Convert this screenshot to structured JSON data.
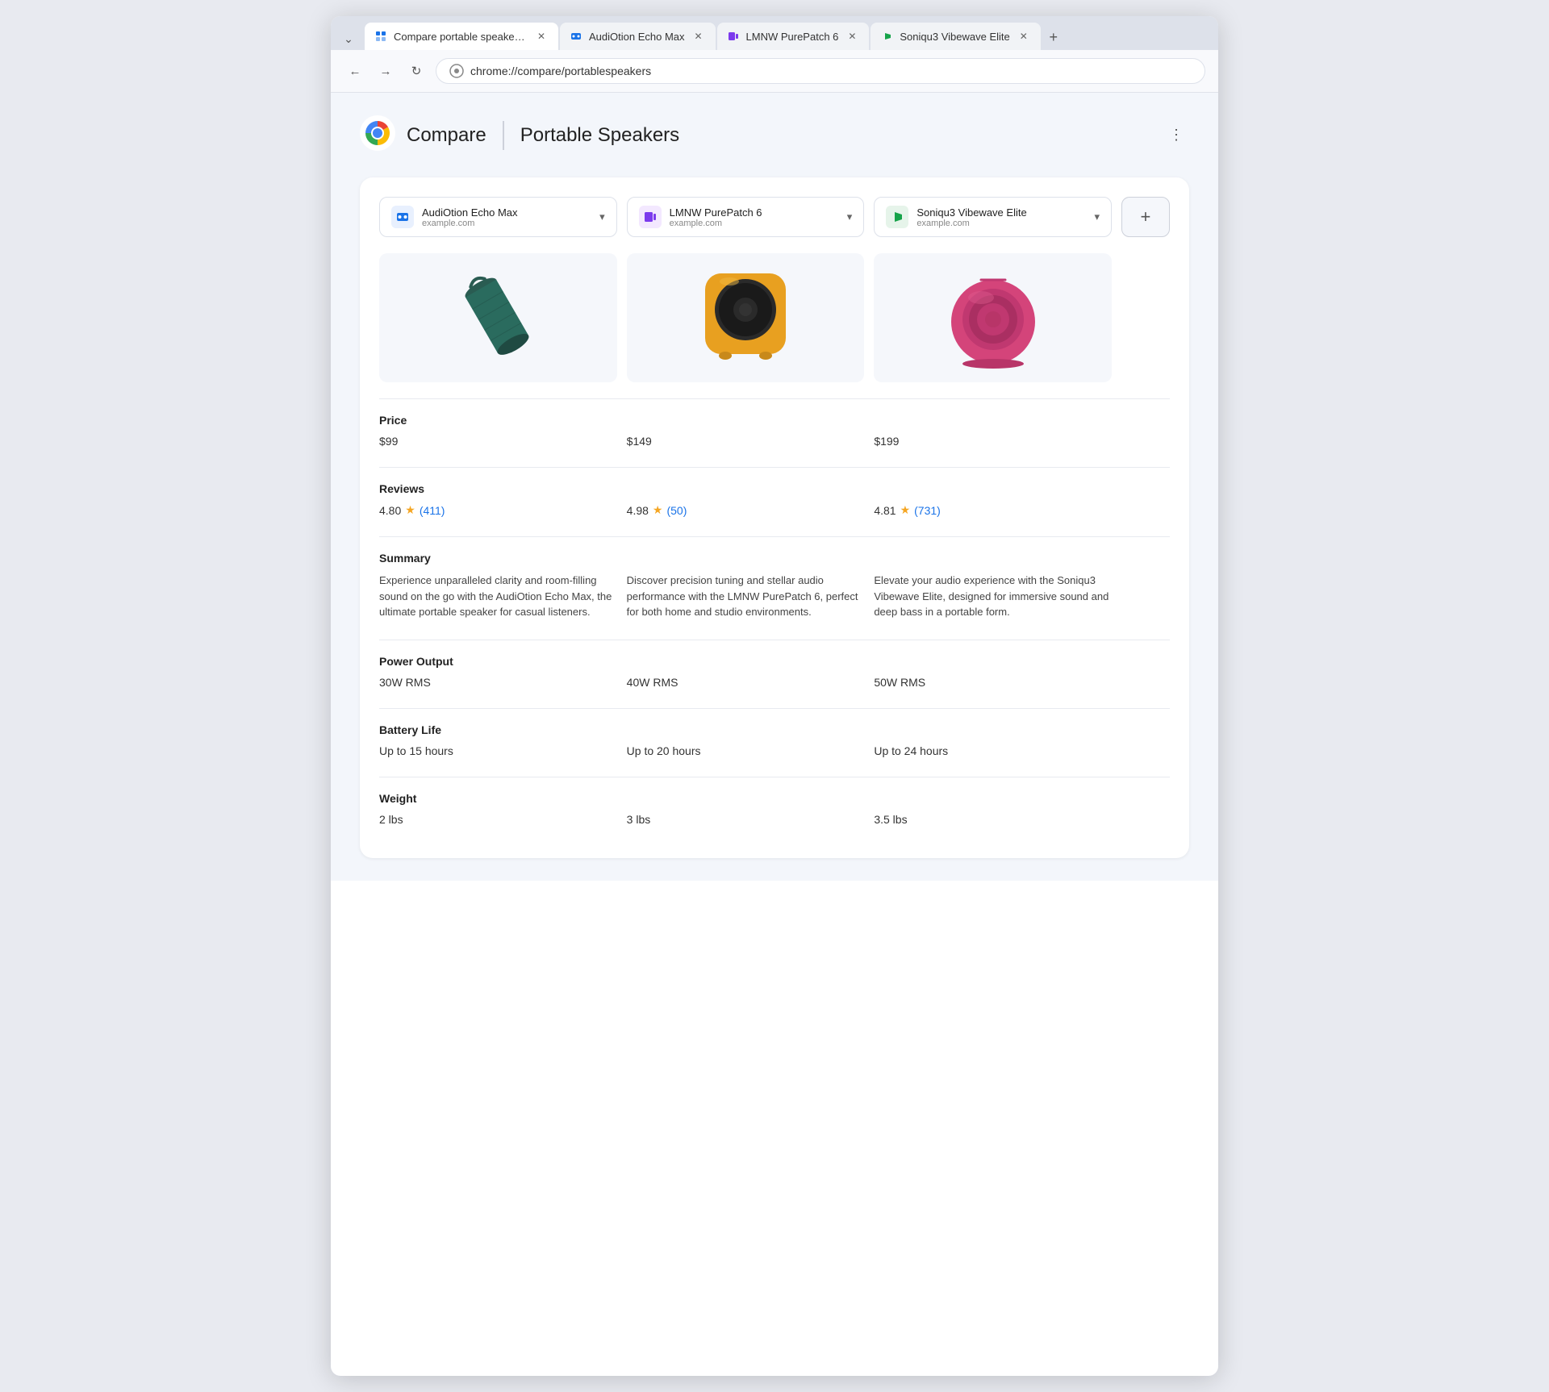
{
  "browser": {
    "tabs": [
      {
        "id": "tab-compare",
        "label": "Compare portable speaker…",
        "favicon": "compare-icon",
        "favicon_color": "#1a73e8",
        "active": true
      },
      {
        "id": "tab-audiootion",
        "label": "AudiOtion Echo Max",
        "favicon": "audio-icon",
        "favicon_color": "#1a73e8",
        "active": false
      },
      {
        "id": "tab-lmnw",
        "label": "LMNW PurePatch 6",
        "favicon": "speaker-icon",
        "favicon_color": "#7c3aed",
        "active": false
      },
      {
        "id": "tab-soniqu3",
        "label": "Soniqu3 Vibewave Elite",
        "favicon": "music-icon",
        "favicon_color": "#16a34a",
        "active": false
      }
    ],
    "url": "chrome://compare/portablespeakers",
    "url_icon": "chrome-icon"
  },
  "page": {
    "app_name": "Compare",
    "title": "Portable Speakers",
    "menu_label": "⋮"
  },
  "products": [
    {
      "id": "audiootion",
      "name": "AudiOtion Echo Max",
      "domain": "example.com",
      "favicon_color": "#1a73e8",
      "price": "$99",
      "rating": "4.80",
      "review_count": "411",
      "summary": "Experience unparalleled clarity and room-filling sound on the go with the AudiOtion Echo Max, the ultimate portable speaker for casual listeners.",
      "power_output": "30W RMS",
      "battery_life": "Up to 15 hours",
      "weight": "2 lbs"
    },
    {
      "id": "lmnw",
      "name": "LMNW PurePatch 6",
      "domain": "example.com",
      "favicon_color": "#7c3aed",
      "price": "$149",
      "rating": "4.98",
      "review_count": "50",
      "summary": "Discover precision tuning and stellar audio performance with the LMNW PurePatch 6, perfect for both home and studio environments.",
      "power_output": "40W RMS",
      "battery_life": "Up to 20 hours",
      "weight": "3 lbs"
    },
    {
      "id": "soniqu3",
      "name": "Soniqu3 Vibewave Elite",
      "domain": "example.com",
      "favicon_color": "#16a34a",
      "price": "$199",
      "rating": "4.81",
      "review_count": "731",
      "summary": "Elevate your audio experience with the Soniqu3 Vibewave Elite, designed for immersive sound and deep bass in a portable form.",
      "power_output": "50W RMS",
      "battery_life": "Up to 24 hours",
      "weight": "3.5 lbs"
    }
  ],
  "sections": [
    {
      "id": "price",
      "label": "Price"
    },
    {
      "id": "reviews",
      "label": "Reviews"
    },
    {
      "id": "summary",
      "label": "Summary"
    },
    {
      "id": "power_output",
      "label": "Power Output"
    },
    {
      "id": "battery_life",
      "label": "Battery Life"
    },
    {
      "id": "weight",
      "label": "Weight"
    }
  ],
  "add_product_label": "+",
  "nav": {
    "back": "←",
    "forward": "→",
    "reload": "↻"
  }
}
